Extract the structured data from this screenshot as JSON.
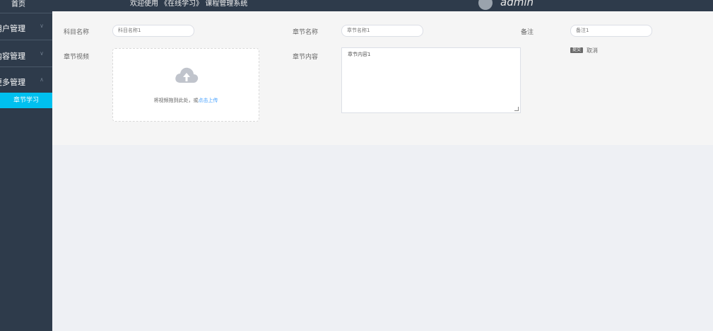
{
  "header": {
    "welcome_text": "欢迎使用 《在线学习》 课程管理系统",
    "username": "admin"
  },
  "sidebar": {
    "home": "首页",
    "menus": [
      {
        "label": "用户管理"
      },
      {
        "label": "内容管理"
      },
      {
        "label": "更多管理"
      }
    ],
    "active_sub": "章节学习"
  },
  "form": {
    "subject_label": "科目名称",
    "subject_value": "科目名称1",
    "chapter_label": "章节名称",
    "chapter_value": "章节名称1",
    "remark_label": "备注",
    "remark_value": "备注1",
    "video_label": "章节视频",
    "upload_hint": "将视频拖到此处，或",
    "upload_link": "点击上传",
    "content_label": "章节内容",
    "content_value": "章节内容1",
    "save_label": "提交",
    "cancel_label": "取消"
  },
  "colors": {
    "sidebar_bg": "#2e3b4b",
    "active_item": "#00c0ef",
    "link": "#409eff"
  }
}
